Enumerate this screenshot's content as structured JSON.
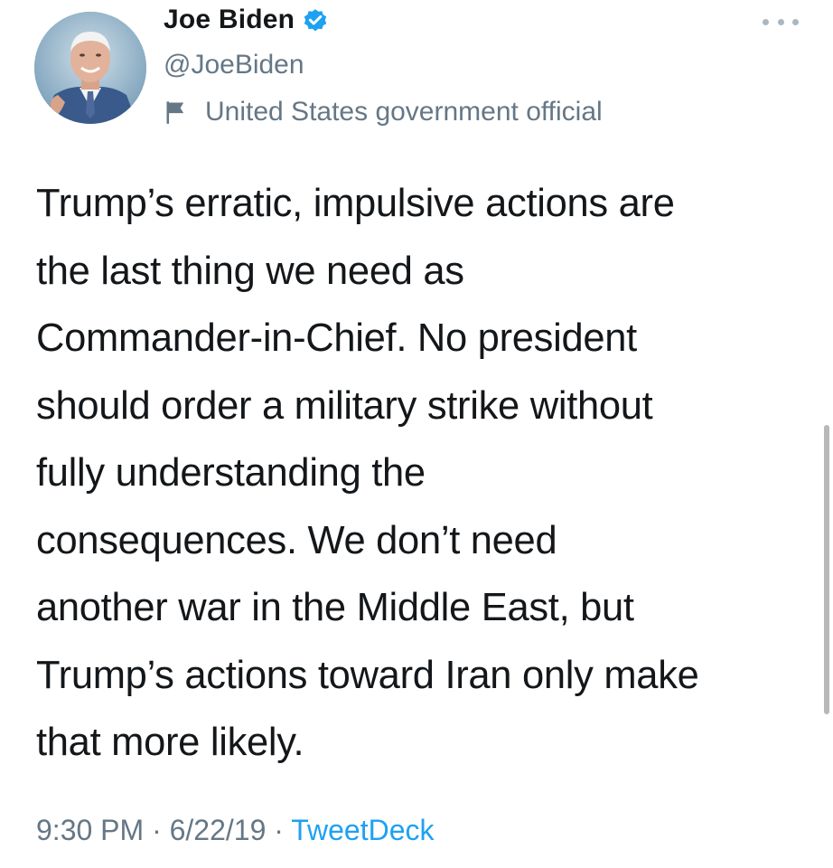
{
  "tweet": {
    "author": {
      "display_name": "Joe Biden",
      "handle": "@JoeBiden",
      "label": "United States government official",
      "avatar_icon": "avatar",
      "verified_icon": "verified-badge-icon"
    },
    "body_lines": [
      "Trump’s erratic, impulsive actions are",
      "the last thing we need as",
      "Commander-in-Chief. No president",
      "should order a military strike without",
      "fully understanding the",
      "consequences. We don’t need",
      "another war in the Middle East, but",
      "Trump’s actions toward Iran only make",
      "that more likely."
    ],
    "meta": {
      "time": "9:30 PM",
      "separator": " · ",
      "date": "6/22/19",
      "source": "TweetDeck"
    }
  },
  "colors": {
    "text": "#14171a",
    "secondary": "#657786",
    "accent": "#1da1f2",
    "verified": "#1da1f2"
  }
}
